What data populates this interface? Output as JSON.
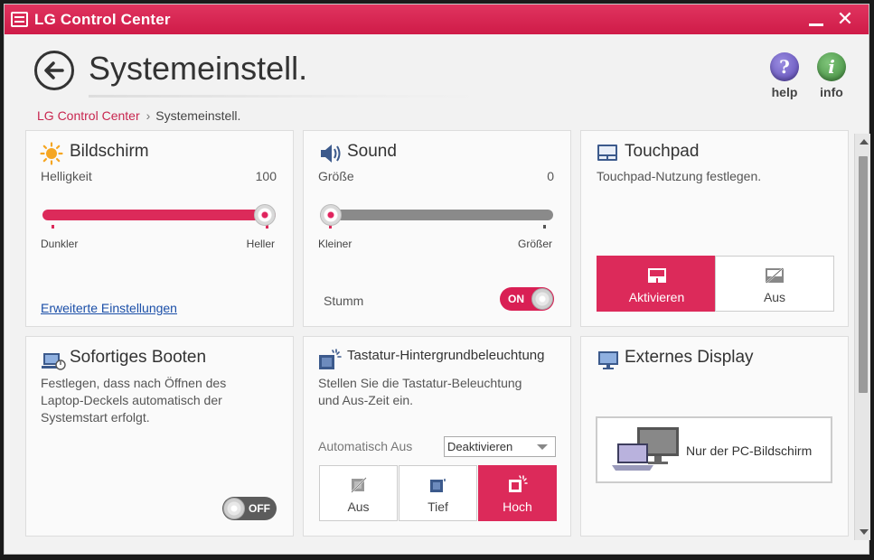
{
  "window": {
    "title": "LG Control Center"
  },
  "header": {
    "title": "Systemeinstell.",
    "help_label": "help",
    "info_label": "info",
    "help_glyph": "?",
    "info_glyph": "i"
  },
  "breadcrumb": {
    "root": "LG Control Center",
    "separator": "›",
    "current": "Systemeinstell."
  },
  "colors": {
    "accent": "#dc2a5a",
    "link": "#1b4fa8",
    "titlebar": "#d4234f"
  },
  "bildschirm": {
    "title": "Bildschirm",
    "icon": "sun-icon",
    "brightness_label": "Helligkeit",
    "brightness_value": "100",
    "brightness_fraction": 1.0,
    "min_label": "Dunkler",
    "max_label": "Heller",
    "advanced_link": "Erweiterte Einstellungen"
  },
  "sound": {
    "title": "Sound",
    "icon": "speaker-icon",
    "size_label": "Größe",
    "size_value": "0",
    "size_fraction": 0.0,
    "min_label": "Kleiner",
    "max_label": "Größer",
    "mute_label": "Stumm",
    "mute_toggle": "ON"
  },
  "touchpad": {
    "title": "Touchpad",
    "icon": "touchpad-icon",
    "description": "Touchpad-Nutzung festlegen.",
    "buttons": [
      {
        "label": "Aktivieren",
        "icon": "touchpad-on-icon",
        "active": true
      },
      {
        "label": "Aus",
        "icon": "touchpad-off-icon",
        "active": false
      }
    ]
  },
  "booten": {
    "title": "Sofortiges Booten",
    "icon": "laptop-power-icon",
    "description_lines": [
      "Festlegen, dass nach Öffnen des",
      "Laptop-Deckels automatisch der",
      "Systemstart erfolgt."
    ],
    "toggle": "OFF"
  },
  "tastatur": {
    "title": "Tastatur-Hintergrundbeleuchtung",
    "icon": "keyboard-light-icon",
    "description_lines": [
      "Stellen Sie die Tastatur-Beleuchtung",
      "und Aus-Zeit ein."
    ],
    "auto_off_label": "Automatisch Aus",
    "auto_off_value": "Deaktivieren",
    "buttons": [
      {
        "label": "Aus",
        "active": false
      },
      {
        "label": "Tief",
        "active": false
      },
      {
        "label": "Hoch",
        "active": true
      }
    ]
  },
  "display": {
    "title": "Externes Display",
    "icon": "monitor-icon",
    "button_label": "Nur der PC-Bildschirm"
  }
}
